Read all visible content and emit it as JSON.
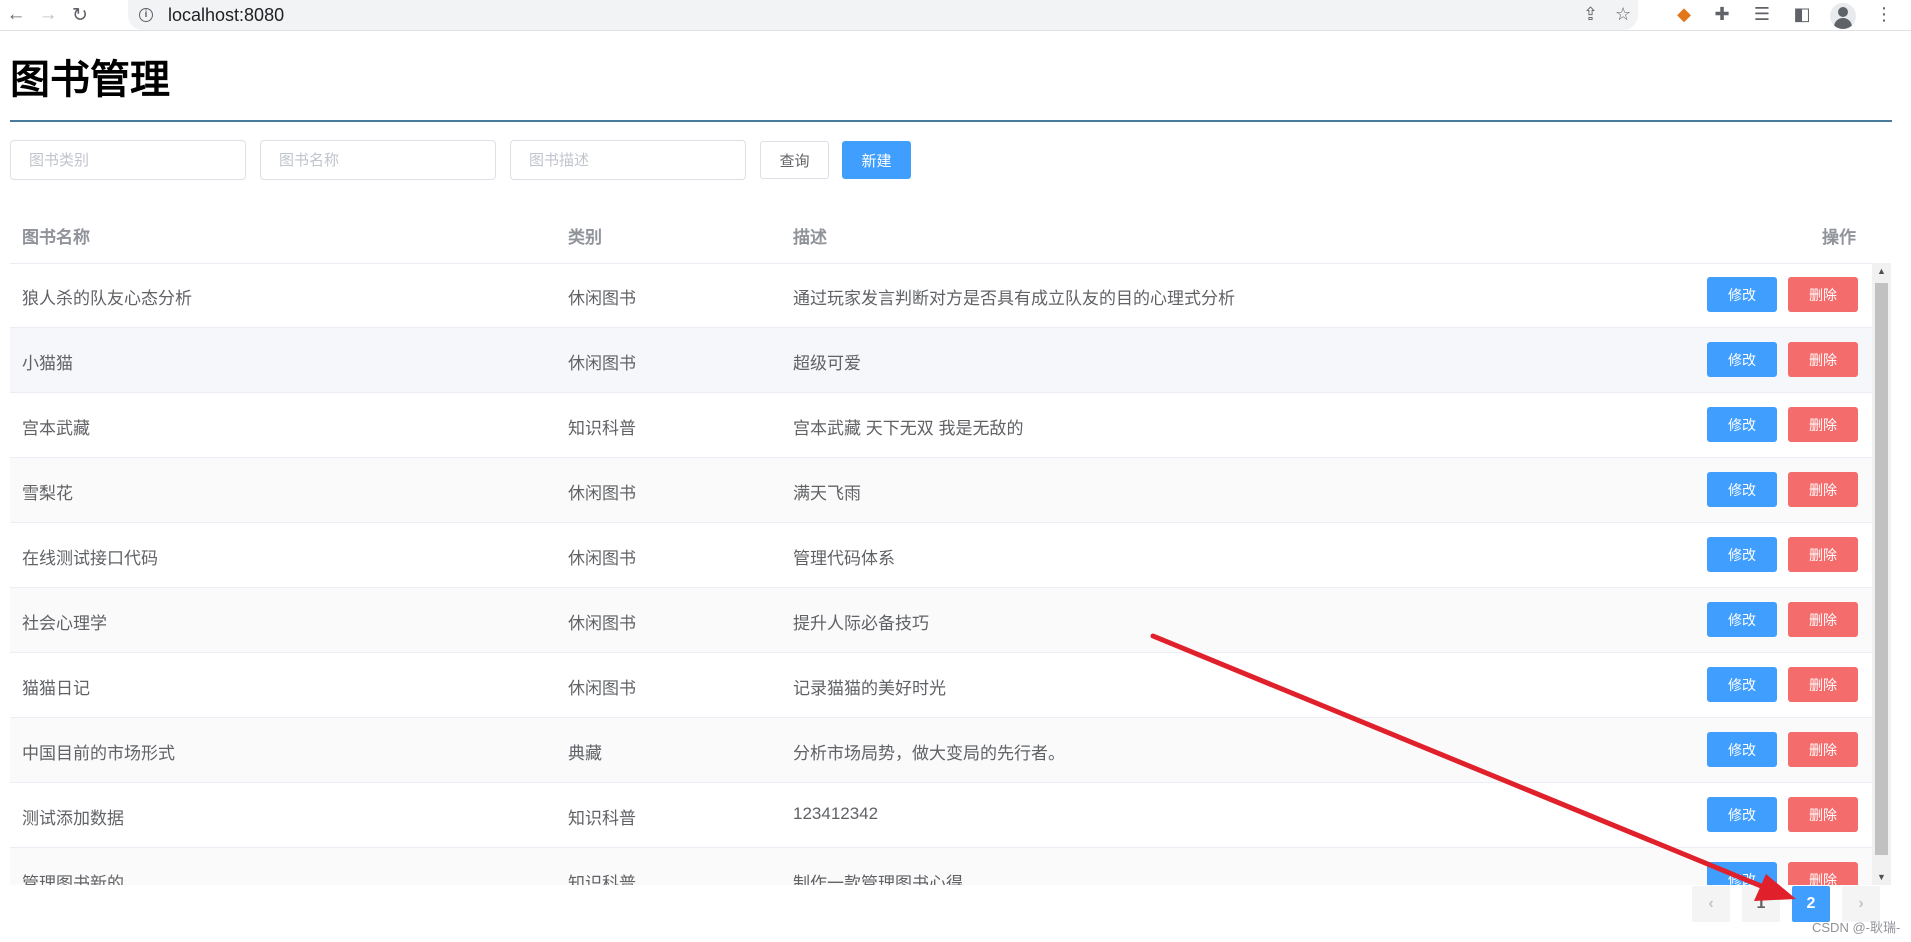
{
  "browser": {
    "url": "localhost:8080"
  },
  "page": {
    "title": "图书管理"
  },
  "filters": {
    "category_placeholder": "图书类别",
    "name_placeholder": "图书名称",
    "description_placeholder": "图书描述",
    "query_label": "查询",
    "create_label": "新建"
  },
  "table": {
    "columns": {
      "name": "图书名称",
      "category": "类别",
      "description": "描述",
      "actions": "操作"
    },
    "edit_label": "修改",
    "delete_label": "删除",
    "rows": [
      {
        "name": "狼人杀的队友心态分析",
        "category": "休闲图书",
        "description": "通过玩家发言判断对方是否具有成立队友的目的心理式分析"
      },
      {
        "name": "小猫猫",
        "category": "休闲图书",
        "description": "超级可爱"
      },
      {
        "name": "宫本武藏",
        "category": "知识科普",
        "description": "宫本武藏 天下无双 我是无敌的"
      },
      {
        "name": "雪梨花",
        "category": "休闲图书",
        "description": "满天飞雨"
      },
      {
        "name": "在线测试接口代码",
        "category": "休闲图书",
        "description": "管理代码体系"
      },
      {
        "name": "社会心理学",
        "category": "休闲图书",
        "description": "提升人际必备技巧"
      },
      {
        "name": "猫猫日记",
        "category": "休闲图书",
        "description": "记录猫猫的美好时光"
      },
      {
        "name": "中国目前的市场形式",
        "category": "典藏",
        "description": "分析市场局势，做大变局的先行者。"
      },
      {
        "name": "测试添加数据",
        "category": "知识科普",
        "description": "123412342"
      },
      {
        "name": "管理图书新的",
        "category": "知识科普",
        "description": "制作一款管理图书心得"
      }
    ]
  },
  "pagination": {
    "prev": "‹",
    "pages": [
      "1",
      "2"
    ],
    "current": "2",
    "next": "›"
  },
  "annotation": {
    "arrow_color": "#e0202a"
  },
  "watermark": "CSDN @-耿瑞-",
  "colors": {
    "primary": "#409eff",
    "danger": "#f56c6c",
    "title_rule": "#4a7a9c"
  }
}
